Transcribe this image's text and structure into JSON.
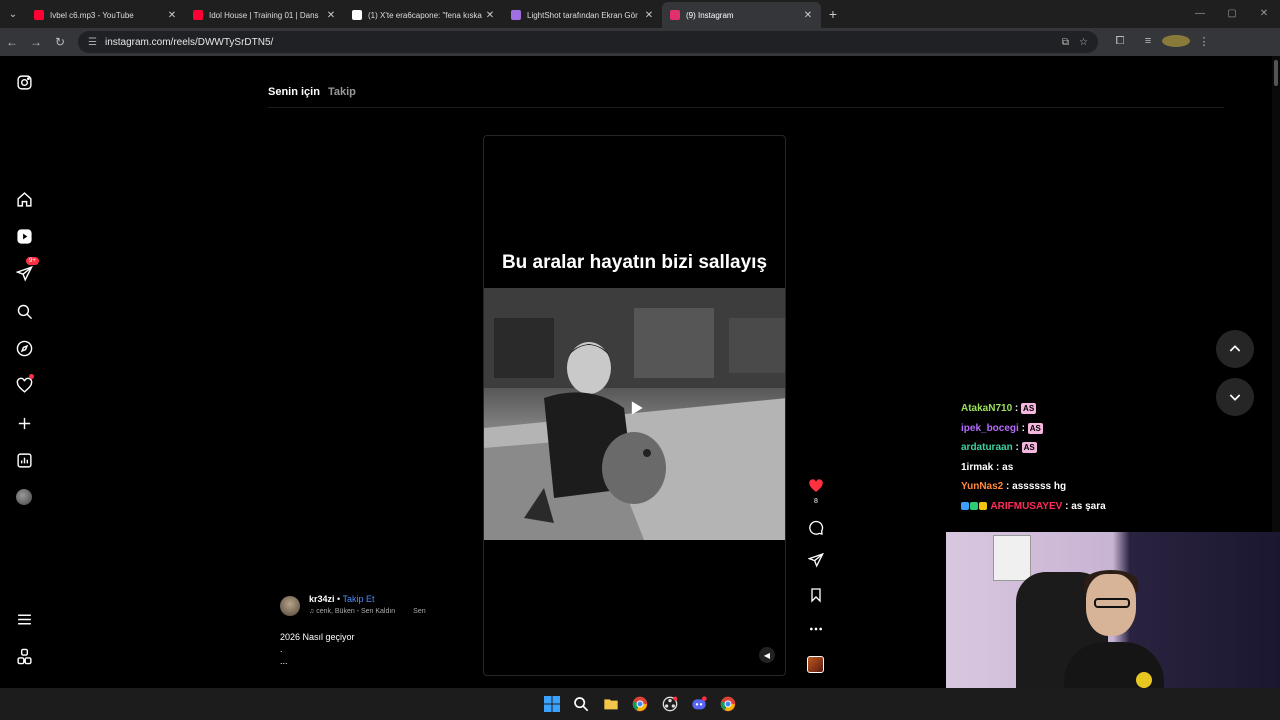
{
  "browser": {
    "tabs": [
      {
        "title": "Ivbel c6.mp3 - YouTube",
        "favicon_color": "#ff0033",
        "active": false
      },
      {
        "title": "Idol House | Training 01 | Dans",
        "favicon_color": "#ff0033",
        "active": false
      },
      {
        "title": "(1) X'te era6capone: \"fena kıska",
        "favicon_color": "#ffffff",
        "active": false
      },
      {
        "title": "LightShot tarafından Ekran Gör",
        "favicon_color": "#a070e0",
        "active": false
      },
      {
        "title": "(9) Instagram",
        "favicon_color": "#e1306c",
        "active": true
      }
    ],
    "url": "instagram.com/reels/DWWTySrDTN5/"
  },
  "sidebar": {
    "notification_badge": "9+",
    "items": [
      "instagram-icon",
      "home-icon",
      "reels-icon",
      "messages-icon",
      "search-icon",
      "explore-icon",
      "notifications-icon",
      "create-icon",
      "dashboard-icon",
      "profile-icon",
      "more-icon",
      "also-from-meta-icon"
    ]
  },
  "feed": {
    "tab_for_you": "Senin için",
    "tab_following": "Takip"
  },
  "reel": {
    "caption_overlay": "Bu aralar hayatın bizi sallayış",
    "author": "kr34zi",
    "separator": "•",
    "follow_label": "Takip Et",
    "music": "cenk, Büken - Sen Kaldın",
    "music_trail": "Sen",
    "description_line1": "2026 Nasıl geçiyor",
    "description_line2": ".",
    "description_line3": "...",
    "like_count": "8"
  },
  "chat": [
    {
      "user": "AtakaN710",
      "color": "#9be05a",
      "message": "",
      "emote": "AS"
    },
    {
      "user": "ipek_bocegi",
      "color": "#b66bff",
      "message": "",
      "emote": "AS"
    },
    {
      "user": "ardaturaan",
      "color": "#3ed1a0",
      "message": "",
      "emote": "AS"
    },
    {
      "user": "1irmak",
      "color": "#ffffff",
      "message": "as",
      "emote": ""
    },
    {
      "user": "YunNas2",
      "color": "#ff8a3d",
      "message": "assssss hg",
      "emote": ""
    },
    {
      "user": "ARIFMUSAYEV",
      "color": "#ff2b5a",
      "message": "as şara",
      "emote": ""
    }
  ],
  "colors": {
    "accent_link": "#4c8dff",
    "like_red": "#ff3040",
    "background": "#000000"
  }
}
